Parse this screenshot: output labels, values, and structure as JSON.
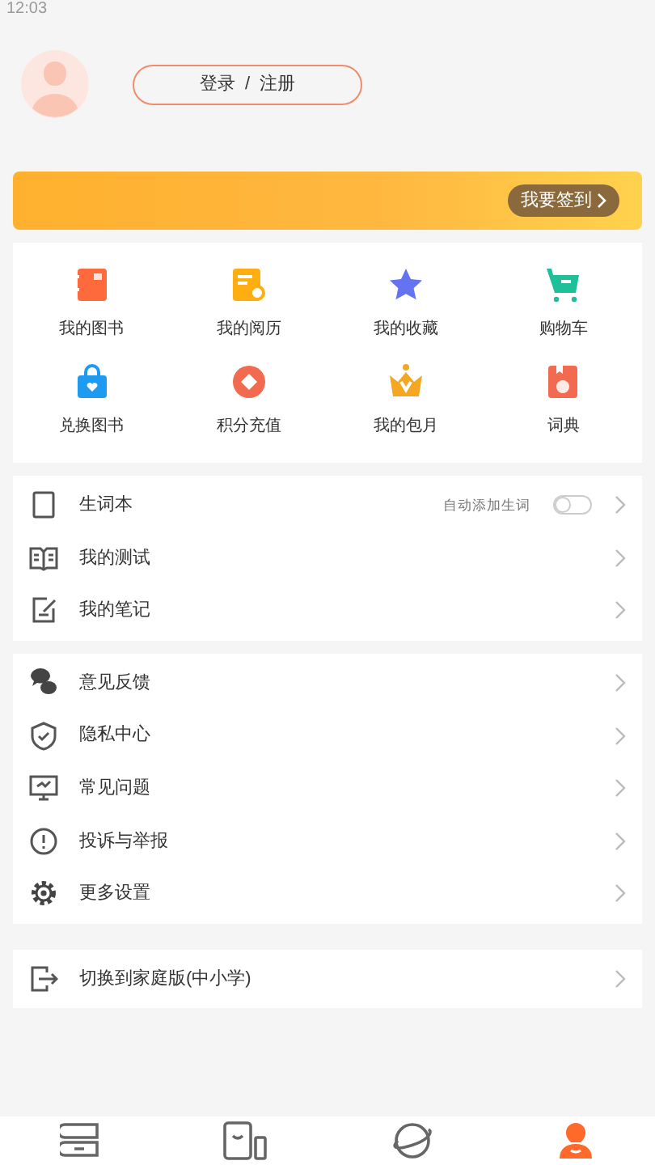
{
  "status_bar": {
    "time": "12:03"
  },
  "profile": {
    "login_button": "登录  /  注册"
  },
  "banner": {
    "checkin_button": "我要签到"
  },
  "shortcuts": [
    {
      "label": "我的图书",
      "kind": "book"
    },
    {
      "label": "我的阅历",
      "kind": "history"
    },
    {
      "label": "我的收藏",
      "kind": "star"
    },
    {
      "label": "购物车",
      "kind": "cart"
    },
    {
      "label": "兑换图书",
      "kind": "bag"
    },
    {
      "label": "积分充值",
      "kind": "coin"
    },
    {
      "label": "我的包月",
      "kind": "crown"
    },
    {
      "label": "词典",
      "kind": "dict"
    }
  ],
  "menu_groups": [
    [
      {
        "label": "生词本",
        "kind": "notebook",
        "toggle_label": "自动添加生词",
        "on": false
      },
      {
        "label": "我的测试",
        "kind": "openbook"
      },
      {
        "label": "我的笔记",
        "kind": "note"
      }
    ],
    [
      {
        "label": "意见反馈",
        "kind": "chat"
      },
      {
        "label": "隐私中心",
        "kind": "shield"
      },
      {
        "label": "常见问题",
        "kind": "monitor"
      },
      {
        "label": "投诉与举报",
        "kind": "alert"
      },
      {
        "label": "更多设置",
        "kind": "gear"
      }
    ],
    [
      {
        "label": "切换到家庭版(中小学)",
        "kind": "exit"
      }
    ]
  ],
  "bottom_nav": [
    {
      "kind": "books",
      "selected": false
    },
    {
      "kind": "devices",
      "selected": false
    },
    {
      "kind": "planet",
      "selected": false
    },
    {
      "kind": "profile",
      "selected": true
    }
  ]
}
